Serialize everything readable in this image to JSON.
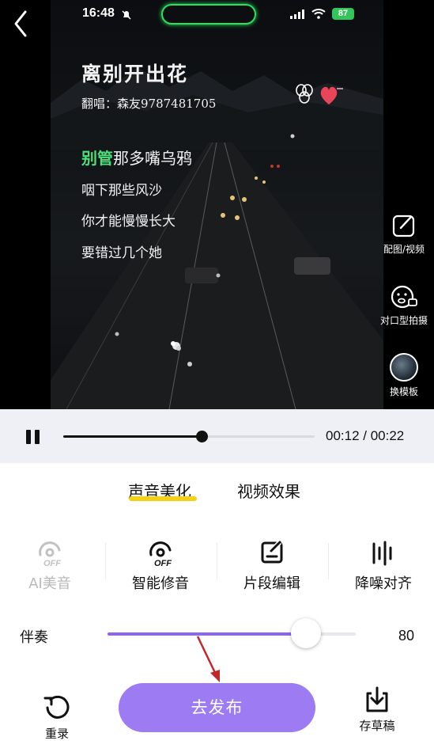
{
  "status_bar": {
    "time": "16:48",
    "battery": "87"
  },
  "lyrics": {
    "title": "离别开出花",
    "credit": "翻唱：森友9787481705",
    "line1_highlight": "别管",
    "line1_rest": "那多嘴乌鸦",
    "line2": "咽下那些风沙",
    "line3": "你才能慢慢长大",
    "line4": "要错过几个她"
  },
  "side_tools": {
    "picture_label": "配图/视频",
    "lipsync_label": "对口型拍摄",
    "template_label": "换模板"
  },
  "playback": {
    "current": "00:12",
    "total": "00:22",
    "separator": " / ",
    "progress": 0.55
  },
  "tabs": {
    "voice": "声音美化",
    "video": "视频效果",
    "active": "voice"
  },
  "tools": {
    "ai": "AI美音",
    "smart": "智能修音",
    "clip": "片段编辑",
    "denoise": "降噪对齐",
    "off_badge": "OFF"
  },
  "accompaniment": {
    "label": "伴奏",
    "value": "80",
    "level": 0.8
  },
  "actions": {
    "publish": "去发布",
    "rerecord": "重录",
    "save_draft": "存草稿"
  },
  "colors": {
    "accent": "#9d7bf2",
    "slider_fill": "#8d66f0",
    "tab_underline": "#f5d312",
    "lyric_highlight": "#4ce07a",
    "island_glow": "#2de05a"
  },
  "icons": [
    "back-icon",
    "bell-off-icon",
    "signal-icon",
    "wifi-icon",
    "edit-icon",
    "lipsync-face-icon",
    "pause-icon",
    "ai-voice-off-icon",
    "smart-tune-off-icon",
    "clip-edit-icon",
    "denoise-align-icon",
    "rerecord-icon",
    "download-icon"
  ]
}
